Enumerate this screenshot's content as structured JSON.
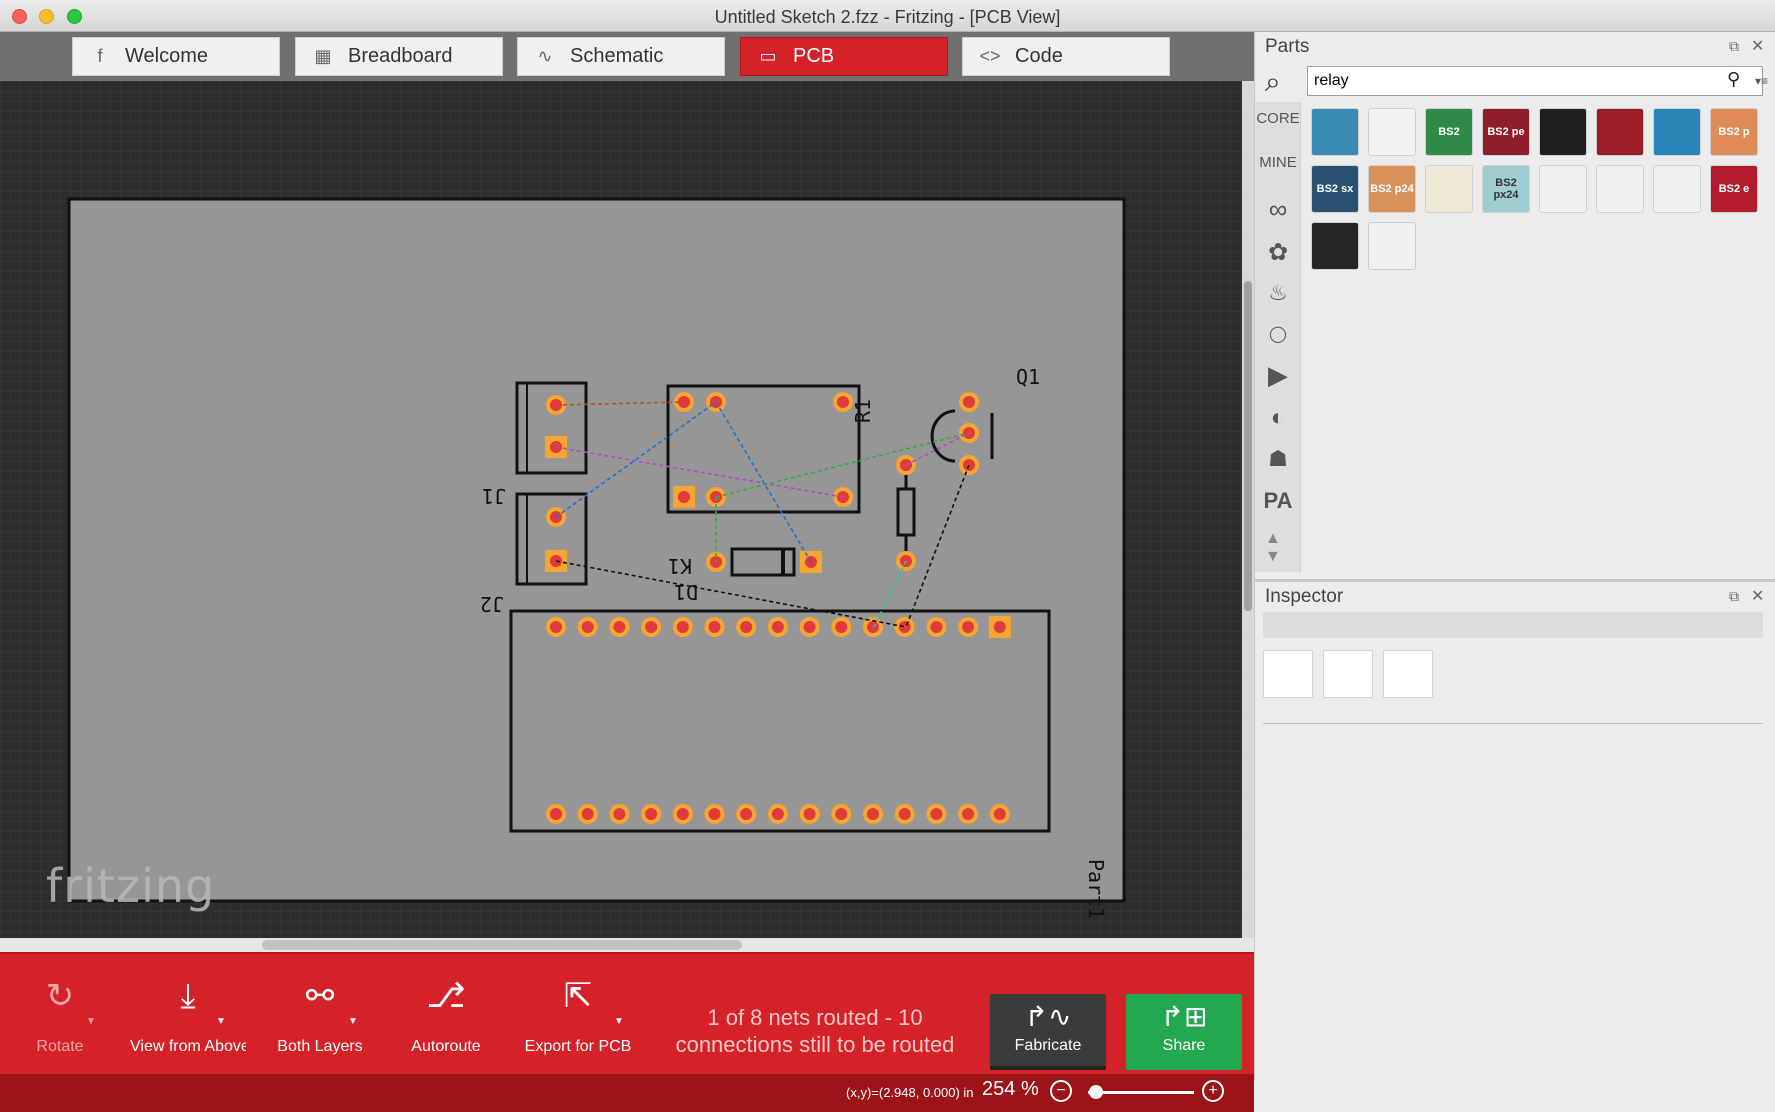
{
  "window": {
    "title": "Untitled Sketch 2.fzz - Fritzing - [PCB View]"
  },
  "tabs": [
    {
      "label": "Welcome",
      "icon": "f",
      "active": false
    },
    {
      "label": "Breadboard",
      "icon": "▦",
      "active": false
    },
    {
      "label": "Schematic",
      "icon": "∿",
      "active": false
    },
    {
      "label": "PCB",
      "icon": "▭",
      "active": true
    },
    {
      "label": "Code",
      "icon": "<>",
      "active": false
    }
  ],
  "canvas": {
    "watermark": "fritzing",
    "board_color": "#969696",
    "pad_color": "#f7a531",
    "labels": {
      "j1": "J1",
      "j2": "J2",
      "r1": "R1",
      "q1": "Q1",
      "k1": "K1",
      "d1": "D1",
      "part1": "Part1"
    }
  },
  "toolbar": {
    "rotate": "Rotate",
    "view_from_above": "View from Above",
    "both_layers": "Both Layers",
    "autoroute": "Autoroute",
    "export_pcb": "Export for PCB",
    "routing_status": "1 of 8 nets routed - 10 connections still to be routed",
    "fabricate": "Fabricate",
    "share": "Share",
    "accent": "#d52128"
  },
  "statusbar": {
    "coords": "(x,y)=(2.948, 0.000) in",
    "zoom": "254",
    "zoom_unit": "%"
  },
  "parts_panel": {
    "title": "Parts",
    "search_value": "relay",
    "bins": [
      "CORE",
      "MINE"
    ],
    "items": [
      {
        "label": "",
        "color": "#3a8bb3"
      },
      {
        "label": "",
        "color": "#f2f2f2"
      },
      {
        "label": "BS2",
        "color": "#2f8a4a"
      },
      {
        "label": "BS2 pe",
        "color": "#8e1e2a"
      },
      {
        "label": "",
        "color": "#1f1f1f"
      },
      {
        "label": "",
        "color": "#9c1c2a"
      },
      {
        "label": "",
        "color": "#2887b8"
      },
      {
        "label": "BS2 p",
        "color": "#e08a55"
      },
      {
        "label": "BS2 sx",
        "color": "#2b5170"
      },
      {
        "label": "BS2 p24",
        "color": "#d9925a"
      },
      {
        "label": "",
        "color": "#eee8d7"
      },
      {
        "label": "BS2 px24",
        "color": "#9fcdd2"
      },
      {
        "label": "",
        "color": "#f0f0f0"
      },
      {
        "label": "",
        "color": "#f0f0f0"
      },
      {
        "label": "",
        "color": "#f0f0f0"
      },
      {
        "label": "BS2 e",
        "color": "#b41c2c"
      },
      {
        "label": "",
        "color": "#262626"
      },
      {
        "label": "",
        "color": "#f0f0f0"
      }
    ]
  },
  "inspector_panel": {
    "title": "Inspector"
  }
}
